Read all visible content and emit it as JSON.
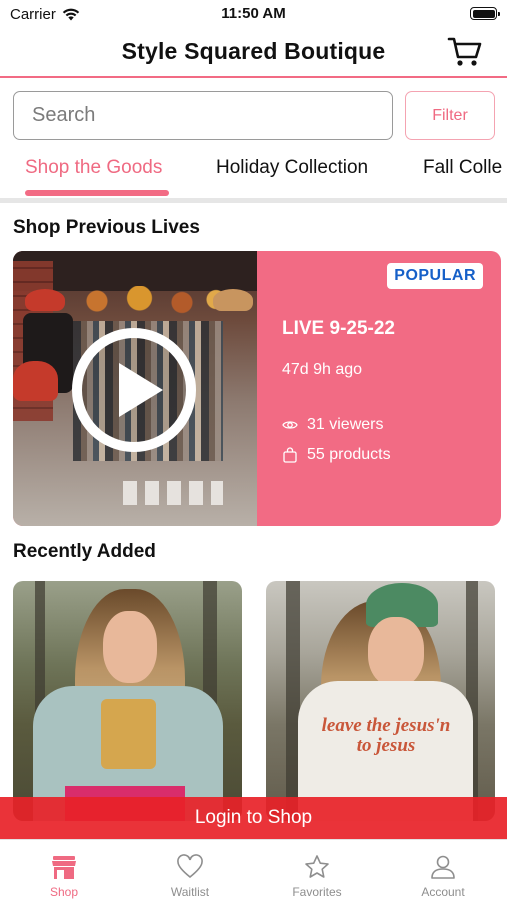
{
  "status_bar": {
    "carrier": "Carrier",
    "time": "11:50 AM"
  },
  "header": {
    "title": "Style Squared Boutique",
    "cart_icon": "cart-icon"
  },
  "search": {
    "placeholder": "Search",
    "value": ""
  },
  "filter": {
    "label": "Filter"
  },
  "tabs": [
    {
      "label": "Shop the Goods",
      "active": true
    },
    {
      "label": "Holiday Collection",
      "active": false
    },
    {
      "label": "Fall Colle",
      "active": false
    }
  ],
  "sections": {
    "previous_lives": "Shop Previous Lives",
    "recently_added": "Recently Added"
  },
  "live_card": {
    "badge": "POPULAR",
    "title": "LIVE 9-25-22",
    "ago": "47d 9h ago",
    "viewers": "31 viewers",
    "products": "55 products",
    "play_icon": "play-icon"
  },
  "products": [
    {
      "shirt_text": ""
    },
    {
      "shirt_text": "leave the jesus'n to jesus"
    }
  ],
  "login_banner": "Login to Shop",
  "bottom_nav": [
    {
      "label": "Shop",
      "icon": "store-icon",
      "active": true
    },
    {
      "label": "Waitlist",
      "icon": "heart-icon",
      "active": false
    },
    {
      "label": "Favorites",
      "icon": "star-icon",
      "active": false
    },
    {
      "label": "Account",
      "icon": "person-icon",
      "active": false
    }
  ],
  "colors": {
    "accent": "#f26b84",
    "login_red": "#e82228",
    "badge_blue": "#1660c8"
  }
}
